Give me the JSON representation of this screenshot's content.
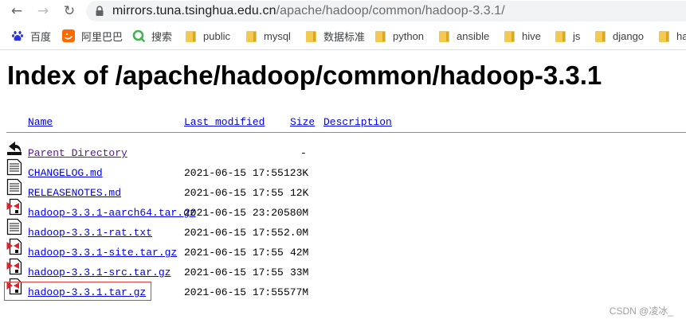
{
  "browser": {
    "url_host": "mirrors.tuna.tsinghua.edu.cn",
    "url_path": "/apache/hadoop/common/hadoop-3.3.1/"
  },
  "bookmarks": [
    {
      "label": "百度",
      "icon": "baidu-icon"
    },
    {
      "label": "阿里巴巴",
      "icon": "alibaba-icon"
    },
    {
      "label": "搜索",
      "icon": "search-icon"
    },
    {
      "label": "public",
      "icon": "folder-icon"
    },
    {
      "label": "mysql",
      "icon": "folder-icon"
    },
    {
      "label": "数据标准",
      "icon": "folder-icon"
    },
    {
      "label": "python",
      "icon": "folder-icon"
    },
    {
      "label": "ansible",
      "icon": "folder-icon"
    },
    {
      "label": "hive",
      "icon": "folder-icon"
    },
    {
      "label": "js",
      "icon": "folder-icon"
    },
    {
      "label": "django",
      "icon": "folder-icon"
    },
    {
      "label": "ha",
      "icon": "folder-icon"
    }
  ],
  "page": {
    "title": "Index of /apache/hadoop/common/hadoop-3.3.1"
  },
  "table": {
    "headers": {
      "name": "Name",
      "last_modified": "Last modified",
      "size": "Size",
      "description": "Description"
    },
    "rows": [
      {
        "name": "Parent Directory",
        "modified": "",
        "size": "-",
        "icon": "back-folder-icon",
        "visited": true
      },
      {
        "name": "CHANGELOG.md",
        "modified": "2021-06-15 17:55",
        "size": "123K",
        "icon": "text-file-icon",
        "visited": false
      },
      {
        "name": "RELEASENOTES.md",
        "modified": "2021-06-15 17:55",
        "size": "12K",
        "icon": "text-file-icon",
        "visited": false
      },
      {
        "name": "hadoop-3.3.1-aarch64.tar.gz",
        "modified": "2021-06-15 23:20",
        "size": "580M",
        "icon": "compressed-file-icon",
        "visited": false
      },
      {
        "name": "hadoop-3.3.1-rat.txt",
        "modified": "2021-06-15 17:55",
        "size": "2.0M",
        "icon": "text-file-icon",
        "visited": false
      },
      {
        "name": "hadoop-3.3.1-site.tar.gz",
        "modified": "2021-06-15 17:55",
        "size": "42M",
        "icon": "compressed-file-icon",
        "visited": false
      },
      {
        "name": "hadoop-3.3.1-src.tar.gz",
        "modified": "2021-06-15 17:55",
        "size": "33M",
        "icon": "compressed-file-icon",
        "visited": false
      },
      {
        "name": "hadoop-3.3.1.tar.gz",
        "modified": "2021-06-15 17:55",
        "size": "577M",
        "icon": "compressed-file-icon",
        "visited": false
      }
    ]
  },
  "watermark": "CSDN @凌冰_",
  "colors": {
    "link": "#0000ee",
    "visited_link": "#551a8b",
    "highlight_border": "#e0413c"
  }
}
